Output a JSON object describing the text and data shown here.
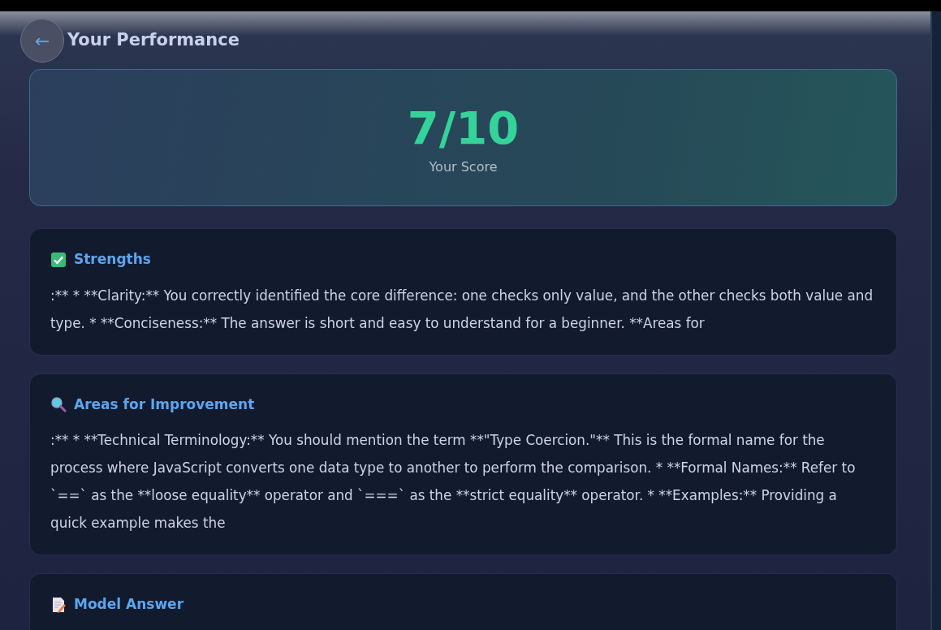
{
  "header": {
    "back_button": "←",
    "title": "Your Performance"
  },
  "score": {
    "value": "7/10",
    "label": "Your Score"
  },
  "sections": [
    {
      "kind": "strengths",
      "title": "Strengths",
      "text": ":** * **Clarity:** You correctly identified the core difference: one checks only value, and the other checks both value and type. * **Conciseness:** The answer is short and easy to understand for a beginner. **Areas for"
    },
    {
      "kind": "improvement",
      "title": "Areas for Improvement",
      "text": ":** * **Technical Terminology:** You should mention the term **\"Type Coercion.\"** This is the formal name for the process where JavaScript converts one data type to another to perform the comparison. * **Formal Names:** Refer to `==` as the **loose equality** operator and `===` as the **strict equality** operator. * **Examples:** Providing a quick example makes the"
    },
    {
      "kind": "model",
      "title": "Model Answer"
    }
  ]
}
